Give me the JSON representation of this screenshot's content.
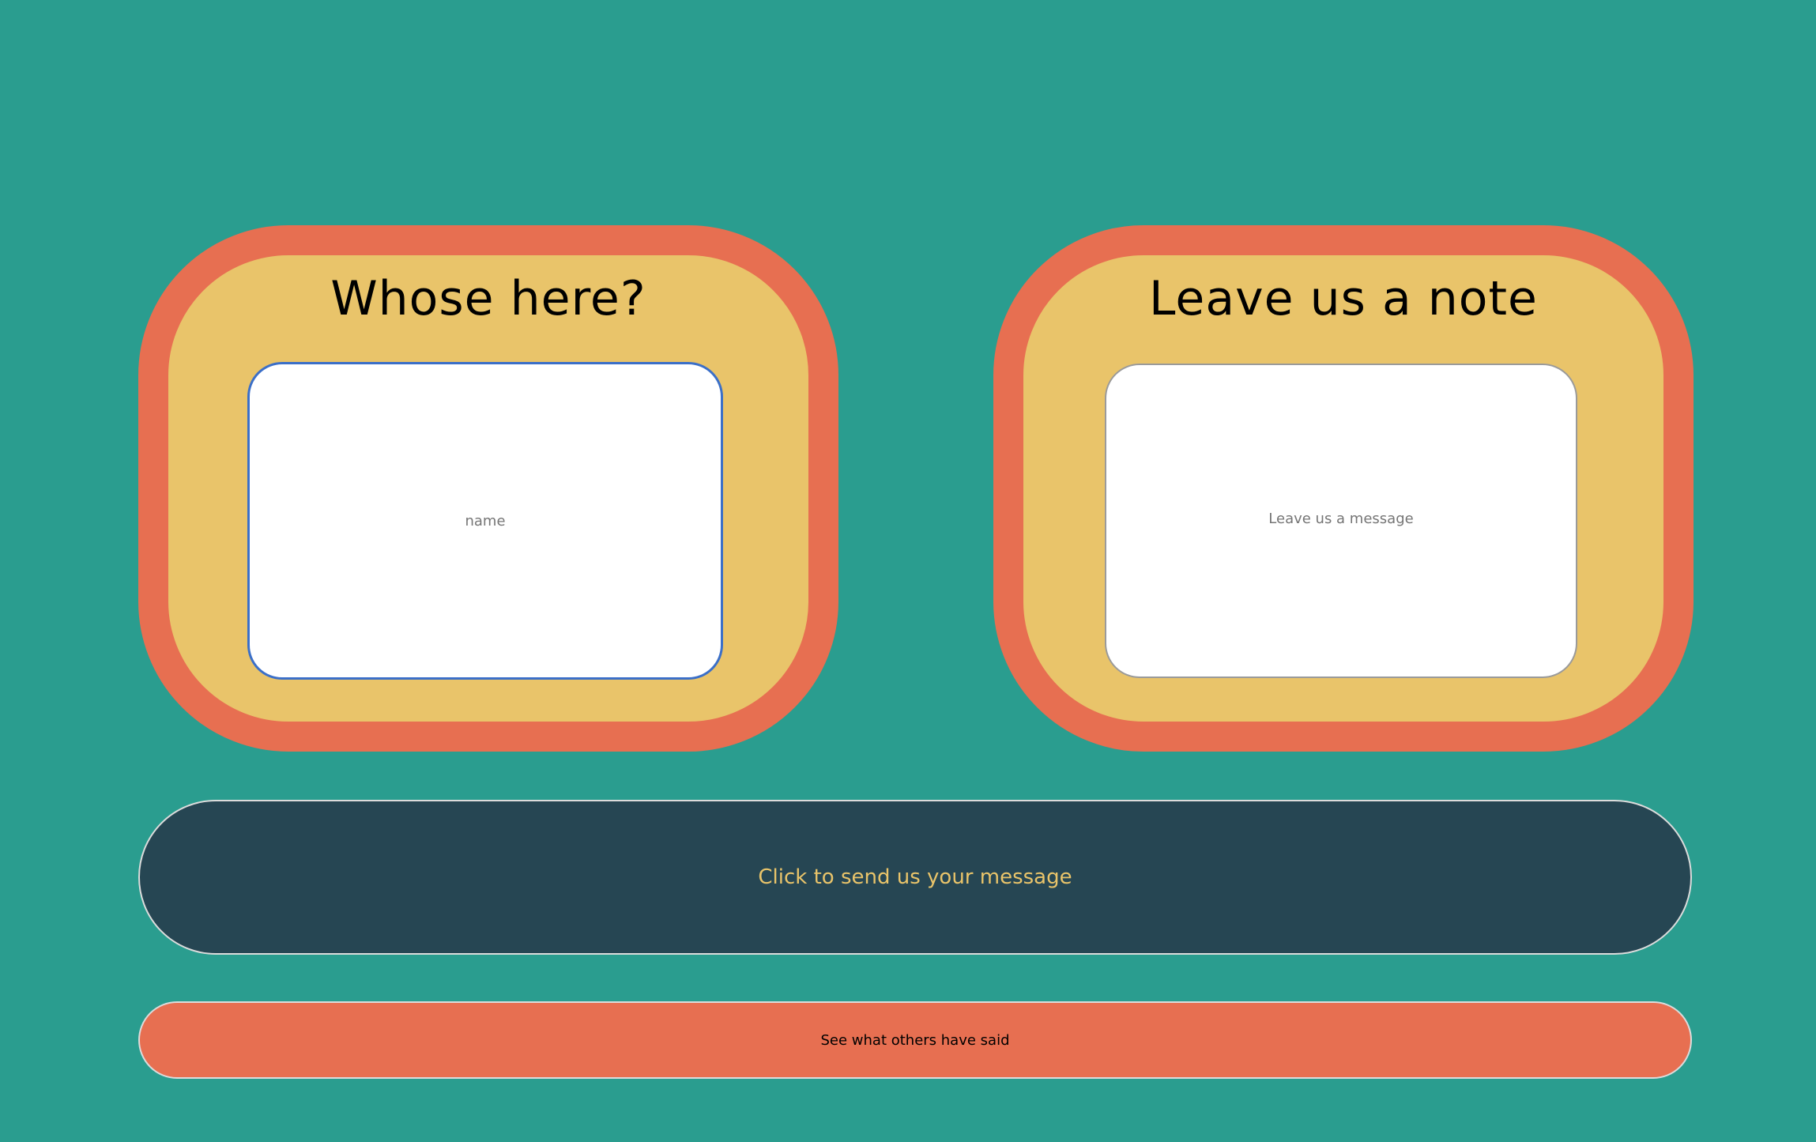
{
  "name_card": {
    "title": "Whose here?",
    "input_placeholder": "name"
  },
  "note_card": {
    "title": "Leave us a note",
    "input_placeholder": "Leave us a message"
  },
  "actions": {
    "send_label": "Click to send us your message",
    "see_label": "See what others have said"
  },
  "colors": {
    "background": "#2a9d8f",
    "card_border": "#e76f51",
    "card_fill": "#e9c46a",
    "send_button": "#264653",
    "send_text": "#e9c46a",
    "see_button": "#e76f51"
  }
}
